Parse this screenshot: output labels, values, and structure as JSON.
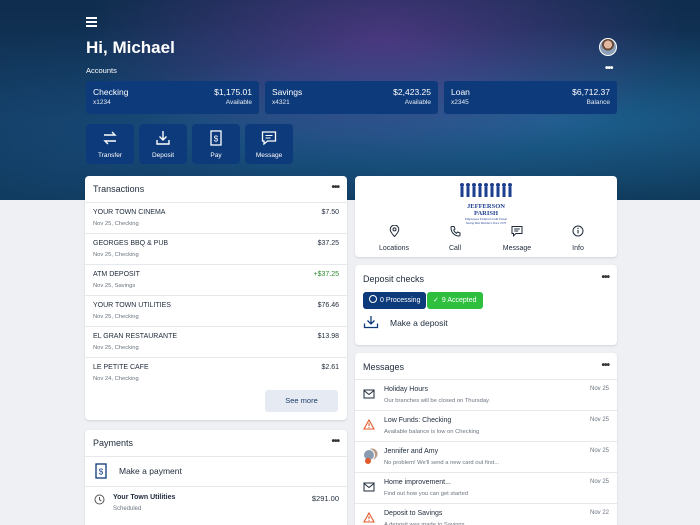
{
  "header": {
    "greeting": "Hi, Michael",
    "accounts_label": "Accounts",
    "more": "•••"
  },
  "accounts": [
    {
      "name": "Checking",
      "number": "x1234",
      "amount": "$1,175.01",
      "sub": "Available"
    },
    {
      "name": "Savings",
      "number": "x4321",
      "amount": "$2,423.25",
      "sub": "Available"
    },
    {
      "name": "Loan",
      "number": "x2345",
      "amount": "$6,712.37",
      "sub": "Balance"
    }
  ],
  "quick_actions": [
    {
      "label": "Transfer",
      "icon": "transfer-icon"
    },
    {
      "label": "Deposit",
      "icon": "deposit-icon"
    },
    {
      "label": "Pay",
      "icon": "pay-icon"
    },
    {
      "label": "Message",
      "icon": "message-icon"
    }
  ],
  "transactions": {
    "title": "Transactions",
    "more": "•••",
    "rows": [
      {
        "name": "YOUR TOWN CINEMA",
        "detail": "Nov 25, Checking",
        "amount": "$7.50",
        "positive": false
      },
      {
        "name": "GEORGES BBQ & PUB",
        "detail": "Nov 25, Checking",
        "amount": "$37.25",
        "positive": false
      },
      {
        "name": "ATM DEPOSIT",
        "detail": "Nov 25, Savings",
        "amount": "+$37.25",
        "positive": true
      },
      {
        "name": "YOUR TOWN UTILITIES",
        "detail": "Nov 25, Checking",
        "amount": "$76.46",
        "positive": false
      },
      {
        "name": "EL GRAN RESTAURANTE",
        "detail": "Nov 25, Checking",
        "amount": "$13.98",
        "positive": false
      },
      {
        "name": "LE PETITE CAFE",
        "detail": "Nov 24, Checking",
        "amount": "$2.61",
        "positive": false
      }
    ],
    "see_more": "See more"
  },
  "payments": {
    "title": "Payments",
    "more": "•••",
    "make_payment": "Make a payment",
    "items": [
      {
        "name": "Your Town Utilities",
        "status": "Scheduled",
        "amount": "$291.00"
      }
    ]
  },
  "branch": {
    "logo_text": "JEFFERSON PARISH",
    "logo_sub": "Employees Federal Credit Union",
    "logo_tag": "Saving Best Members Since 1979",
    "contacts": [
      {
        "label": "Locations",
        "icon": "location-pin-icon"
      },
      {
        "label": "Call",
        "icon": "phone-icon"
      },
      {
        "label": "Message",
        "icon": "message-icon"
      },
      {
        "label": "Info",
        "icon": "info-icon"
      }
    ]
  },
  "deposit_checks": {
    "title": "Deposit checks",
    "more": "•••",
    "processing": "0 Processing",
    "accepted": "9 Accepted",
    "make_deposit": "Make a deposit"
  },
  "messages": {
    "title": "Messages",
    "more": "•••",
    "items": [
      {
        "title": "Holiday Hours",
        "preview": "Our branches will be closed on Thursday.",
        "date": "Nov 25",
        "icon": "mail-icon"
      },
      {
        "title": "Low Funds: Checking",
        "preview": "Available balance is low on Checking",
        "date": "Nov 25",
        "icon": "warning-icon"
      },
      {
        "title": "Jennifer and Amy",
        "preview": "No problem! We'll send a new card out first...",
        "date": "Nov 25",
        "icon": "avatar-icon"
      },
      {
        "title": "Home improvement...",
        "preview": "Find out how you can get started",
        "date": "Nov 25",
        "icon": "mail-icon"
      },
      {
        "title": "Deposit to Savings",
        "preview": "A deposit was made to Savings",
        "date": "Nov 22",
        "icon": "warning-icon"
      }
    ]
  },
  "colors": {
    "primary": "#0d3a7a",
    "positive": "#2e8b2e",
    "accepted": "#2fbf3f",
    "warning": "#e05a2a"
  }
}
